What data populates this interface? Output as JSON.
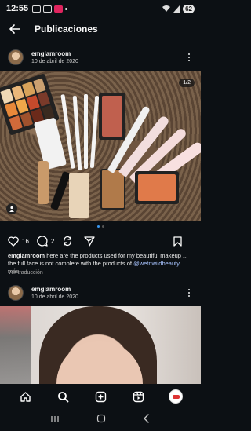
{
  "status_bar": {
    "time": "12:55",
    "battery": "62"
  },
  "header": {
    "title": "Publicaciones"
  },
  "post1": {
    "username": "emglamroom",
    "date": "10 de abril de 2020",
    "counter": "1/2",
    "likes": "16",
    "comments": "2",
    "caption_user": "emglamroom",
    "caption_text": " here are the products used for my beautiful makeup ... the full face is not complete with the products of ",
    "caption_mention": "@wetnwildbeauty",
    "caption_more": "... más",
    "translate": "Ver traducción"
  },
  "post2": {
    "username": "emglamroom",
    "date": "10 de abril de 2020"
  },
  "colors": {
    "background": "#0c1014",
    "link": "#3897f0"
  },
  "icons": {
    "back": "arrow-left-icon",
    "more": "more-vertical-icon",
    "like": "heart-icon",
    "comment": "comment-icon",
    "repost": "repost-icon",
    "share": "share-icon",
    "save": "bookmark-icon",
    "tag": "user-tag-icon",
    "home": "home-icon",
    "search": "search-icon",
    "create": "plus-square-icon",
    "reels": "reels-icon",
    "profile": "profile-avatar-icon"
  }
}
